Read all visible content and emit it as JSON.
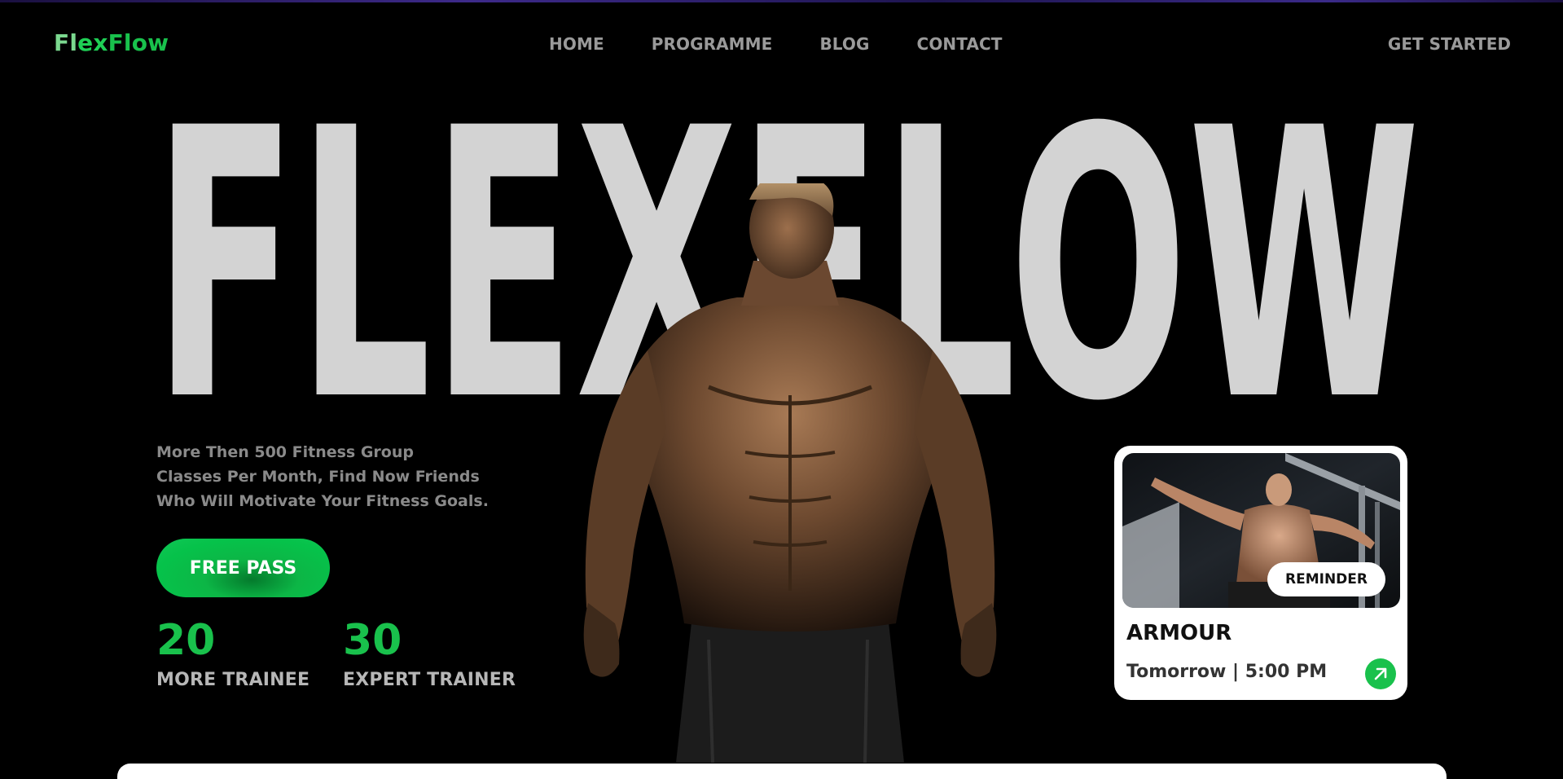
{
  "nav": {
    "logo_part1": "Fl",
    "logo_part2": "ex",
    "logo_part3": "Flow",
    "items": [
      {
        "label": "HOME"
      },
      {
        "label": "PROGRAMME"
      },
      {
        "label": "BLOG"
      },
      {
        "label": "CONTACT"
      }
    ],
    "cta": "GET STARTED"
  },
  "hero": {
    "word": "FLEXFLOW",
    "tagline_lines": [
      "More Then 500 Fitness Group",
      "Classes Per Month, Find Now Friends",
      "Who Will Motivate Your Fitness Goals."
    ],
    "button": "FREE PASS",
    "stats": [
      {
        "value": "20",
        "label": "MORE TRAINEE"
      },
      {
        "value": "30",
        "label": "EXPERT TRAINER"
      }
    ]
  },
  "card": {
    "badge": "REMINDER",
    "title": "ARMOUR",
    "time": "Tomorrow | 5:00 PM",
    "action_icon": "arrow-up-right-icon"
  },
  "colors": {
    "accent": "#19c14c",
    "hero_text": "#d3d3d3",
    "nav_text": "#9a9a9a",
    "background": "#000000"
  }
}
